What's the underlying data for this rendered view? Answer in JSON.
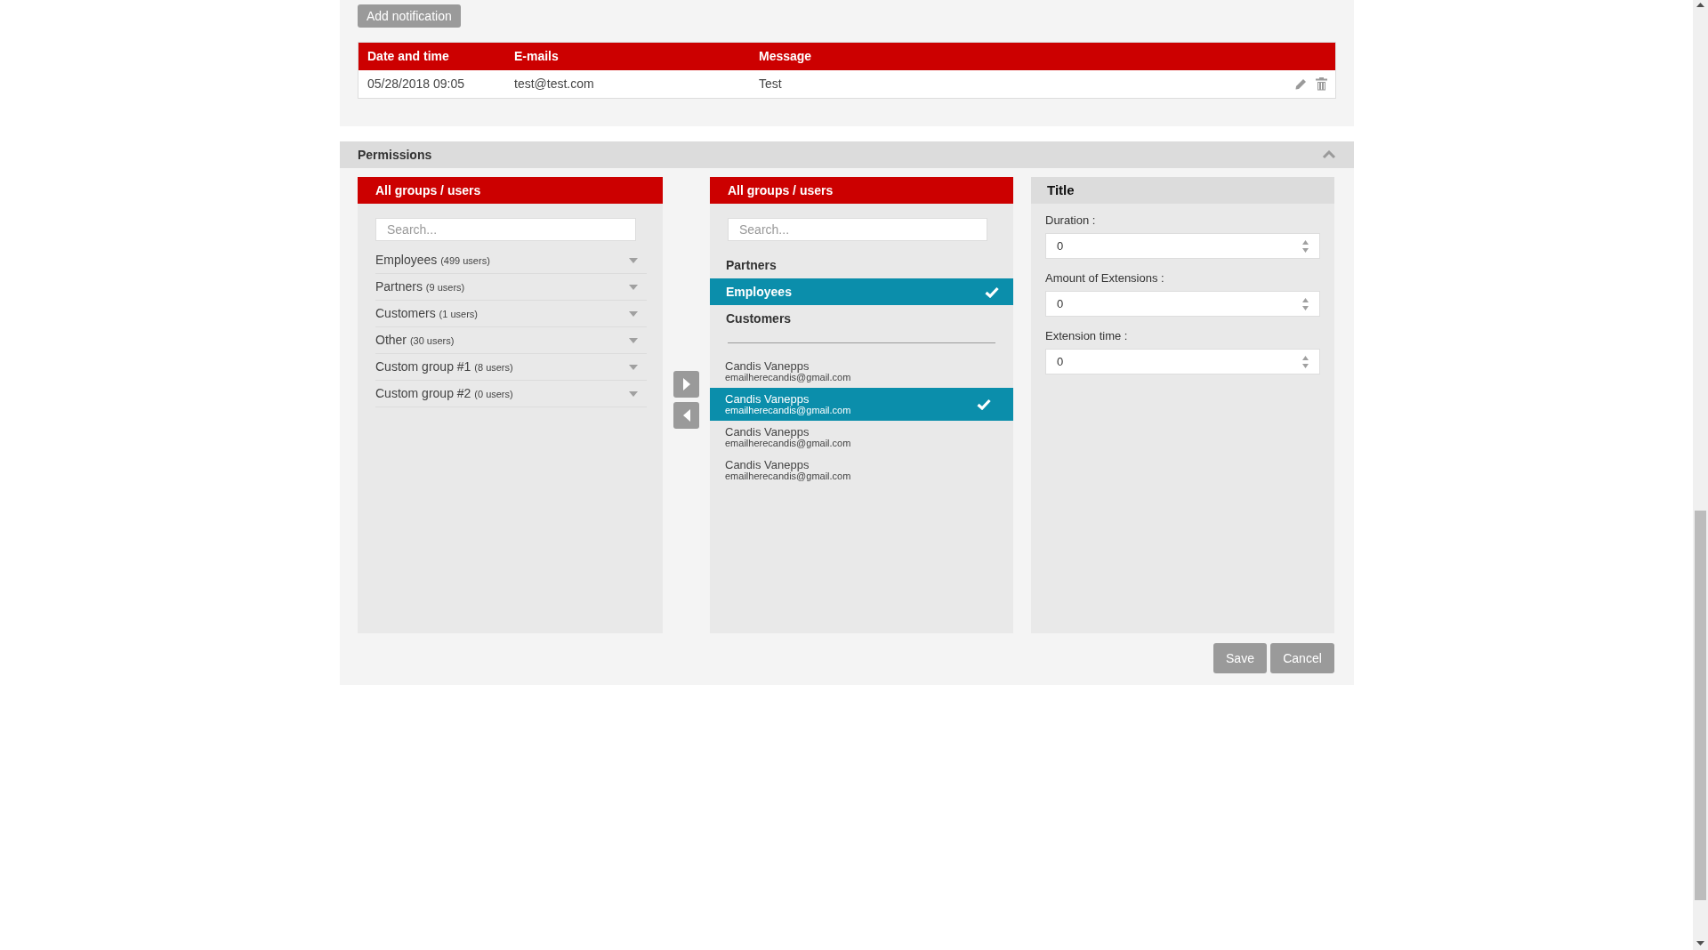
{
  "add_notification_button": "Add notification",
  "notifications_table": {
    "columns": [
      "Date and time",
      "E-mails",
      "Message"
    ],
    "rows": [
      {
        "date_time": "05/28/2018 09:05",
        "emails": "test@test.com",
        "message": "Test"
      }
    ]
  },
  "permissions": {
    "title": "Permissions",
    "expanded": true,
    "source_panel": {
      "title": "All groups / users",
      "search": {
        "placeholder": "Search..."
      },
      "groups": [
        {
          "name": "Employees",
          "count": "(499 users)"
        },
        {
          "name": "Partners",
          "count": "(9 users)"
        },
        {
          "name": "Customers",
          "count": "(1 users)"
        },
        {
          "name": "Other",
          "count": "(30 users)"
        },
        {
          "name": "Custom group #1",
          "count": "(8 users)"
        },
        {
          "name": "Custom group #2",
          "count": "(0 users)"
        }
      ]
    },
    "target_panel": {
      "title": "All groups / users",
      "search": {
        "placeholder": "Search..."
      },
      "groups": [
        {
          "name": "Partners",
          "selected": false
        },
        {
          "name": "Employees",
          "selected": true
        },
        {
          "name": "Customers",
          "selected": false
        }
      ],
      "users": [
        {
          "name": "Candis Vanepps",
          "email": "emailherecandis@gmail.com",
          "selected": false
        },
        {
          "name": "Candis Vanepps",
          "email": "emailherecandis@gmail.com",
          "selected": true
        },
        {
          "name": "Candis Vanepps",
          "email": "emailherecandis@gmail.com",
          "selected": false
        },
        {
          "name": "Candis Vanepps",
          "email": "emailherecandis@gmail.com",
          "selected": false
        }
      ]
    },
    "settings_panel": {
      "title": "Title",
      "fields": [
        {
          "label": "Duration :",
          "value": "0"
        },
        {
          "label": "Amount of Extensions :",
          "value": "0"
        },
        {
          "label": "Extension time :",
          "value": "0"
        }
      ]
    }
  },
  "buttons": [
    "Save",
    "Cancel"
  ]
}
